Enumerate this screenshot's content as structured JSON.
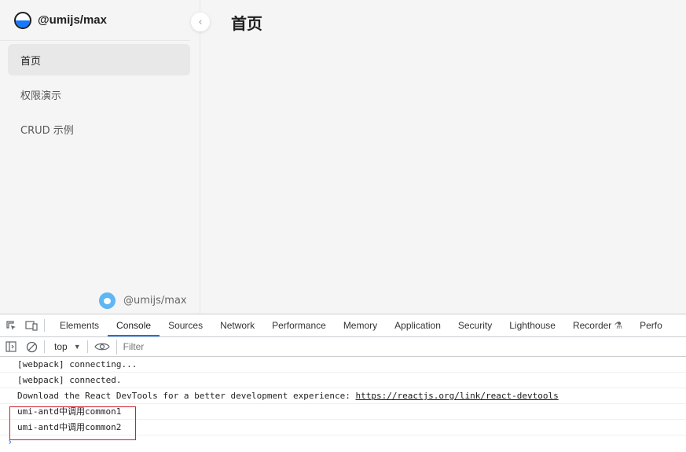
{
  "app": {
    "brand_title": "@umijs/max",
    "collapse_icon": "chevron-left-icon",
    "menu": [
      {
        "label": "首页",
        "active": true
      },
      {
        "label": "权限演示",
        "active": false
      },
      {
        "label": "CRUD 示例",
        "active": false
      }
    ],
    "footer_label": "@umijs/max",
    "page_title": "首页"
  },
  "devtools": {
    "tabs": [
      "Elements",
      "Console",
      "Sources",
      "Network",
      "Performance",
      "Memory",
      "Application",
      "Security",
      "Lighthouse",
      "Recorder",
      "Perfo"
    ],
    "active_tab": "Console",
    "context": "top",
    "filter_placeholder": "Filter",
    "console_lines": [
      "[webpack] connecting...",
      "[webpack] connected.",
      "Download the React DevTools for a better development experience: ",
      "umi-antd中调用common1",
      "umi-antd中调用common2"
    ],
    "devtools_link": "https://reactjs.org/link/react-devtools",
    "prompt_symbol": "›",
    "highlight_color": "#d0202b",
    "link_color": "#1a1a1a"
  }
}
